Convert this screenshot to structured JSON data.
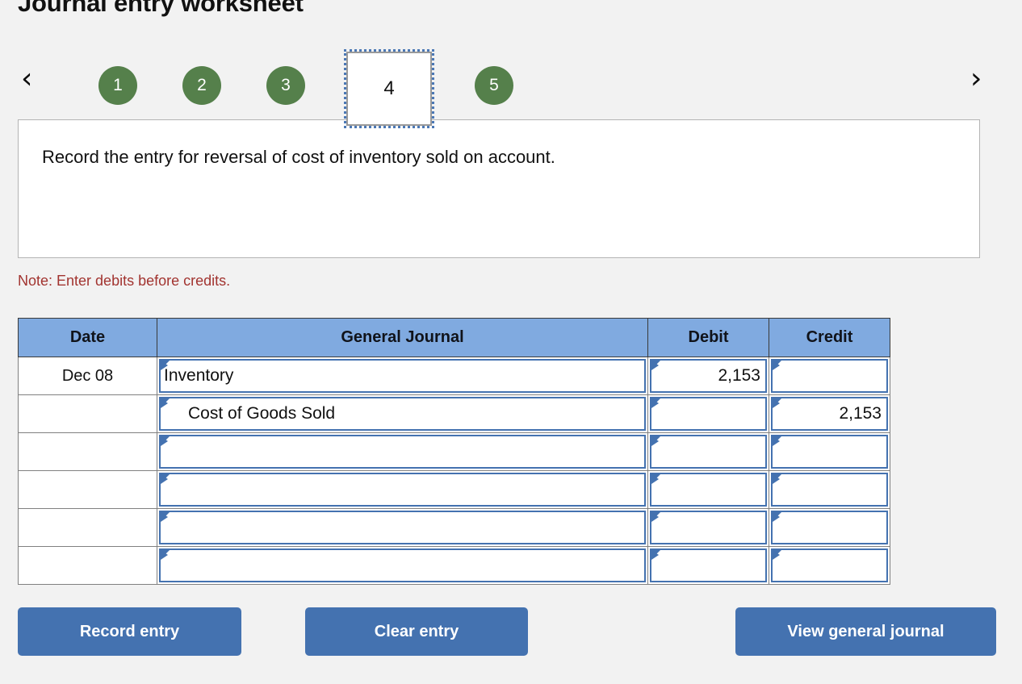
{
  "page": {
    "title": "Journal entry worksheet",
    "background_color": "#f2f2f2"
  },
  "pager": {
    "prev_icon": "chevron-left-icon",
    "next_icon": "chevron-right-icon",
    "prev_glyph": "‹",
    "next_glyph": "›",
    "steps": [
      {
        "label": "1",
        "state": "complete"
      },
      {
        "label": "2",
        "state": "complete"
      },
      {
        "label": "3",
        "state": "complete"
      },
      {
        "label": "4",
        "state": "current"
      },
      {
        "label": "5",
        "state": "complete"
      }
    ],
    "current_step": "4",
    "complete_color": "#55804B",
    "current_border_color": "#4b78b5"
  },
  "instruction": {
    "text": "Record the entry for reversal of cost of inventory sold on account."
  },
  "note": {
    "text": "Note: Enter debits before credits.",
    "color": "#a23430"
  },
  "journal": {
    "header_color": "#80AAE0",
    "columns": [
      {
        "key": "date",
        "label": "Date"
      },
      {
        "key": "gj",
        "label": "General Journal"
      },
      {
        "key": "debit",
        "label": "Debit"
      },
      {
        "key": "credit",
        "label": "Credit"
      }
    ],
    "rows": [
      {
        "date": "Dec 08",
        "account": "Inventory",
        "indent": false,
        "debit": "2,153",
        "credit": ""
      },
      {
        "date": "",
        "account": "Cost of Goods Sold",
        "indent": true,
        "debit": "",
        "credit": "2,153"
      },
      {
        "date": "",
        "account": "",
        "indent": false,
        "debit": "",
        "credit": ""
      },
      {
        "date": "",
        "account": "",
        "indent": false,
        "debit": "",
        "credit": ""
      },
      {
        "date": "",
        "account": "",
        "indent": false,
        "debit": "",
        "credit": ""
      },
      {
        "date": "",
        "account": "",
        "indent": false,
        "debit": "",
        "credit": ""
      }
    ]
  },
  "buttons": {
    "record": "Record entry",
    "clear": "Clear entry",
    "view": "View general journal",
    "color": "#4472b0"
  }
}
